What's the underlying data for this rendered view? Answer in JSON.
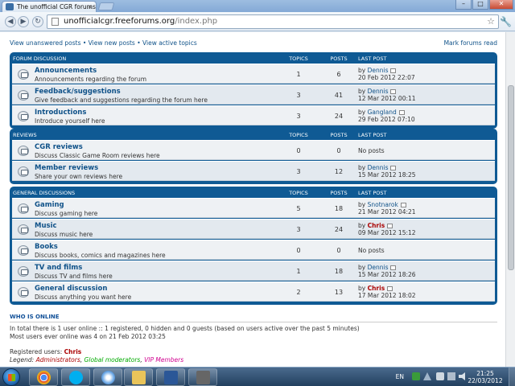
{
  "browser": {
    "tab_title": "The unofficial CGR forums",
    "tab_close": "×",
    "url_host": "unofficialcgr.freeforums.org",
    "url_path": "/index.php",
    "star": "☆",
    "wrench": "🔧",
    "back": "◀",
    "forward": "▶",
    "reload": "↻",
    "minimize": "–",
    "maximize": "□",
    "close": "✕"
  },
  "topbar": {
    "links": "View unanswered posts • View new posts • View active topics",
    "mark_read": "Mark forums read"
  },
  "headers": {
    "topics": "TOPICS",
    "posts": "POSTS",
    "last_post": "LAST POST"
  },
  "categories": [
    {
      "title": "FORUM DISCUSSION",
      "forums": [
        {
          "name": "Announcements",
          "desc": "Announcements regarding the forum",
          "topics": "1",
          "posts": "6",
          "by": "Dennis",
          "date": "20 Feb 2012 22:07",
          "admin": false
        },
        {
          "name": "Feedback/suggestions",
          "desc": "Give feedback and suggestions regarding the forum here",
          "topics": "3",
          "posts": "41",
          "by": "Dennis",
          "date": "12 Mar 2012 00:11",
          "admin": false
        },
        {
          "name": "Introductions",
          "desc": "Introduce yourself here",
          "topics": "3",
          "posts": "24",
          "by": "Gangland",
          "date": "29 Feb 2012 07:10",
          "admin": false
        }
      ]
    },
    {
      "title": "REVIEWS",
      "forums": [
        {
          "name": "CGR reviews",
          "desc": "Discuss Classic Game Room reviews here",
          "topics": "0",
          "posts": "0",
          "by": "",
          "date": "",
          "noposts": "No posts",
          "admin": false
        },
        {
          "name": "Member reviews",
          "desc": "Share your own reviews here",
          "topics": "3",
          "posts": "12",
          "by": "Dennis",
          "date": "15 Mar 2012 18:25",
          "admin": false
        }
      ]
    },
    {
      "title": "GENERAL DISCUSSIONS",
      "forums": [
        {
          "name": "Gaming",
          "desc": "Discuss gaming here",
          "topics": "5",
          "posts": "18",
          "by": "Snotnarok",
          "date": "21 Mar 2012 04:21",
          "admin": false
        },
        {
          "name": "Music",
          "desc": "Discuss music here",
          "topics": "3",
          "posts": "24",
          "by": "Chris",
          "date": "09 Mar 2012 15:12",
          "admin": true
        },
        {
          "name": "Books",
          "desc": "Discuss books, comics and magazines here",
          "topics": "0",
          "posts": "0",
          "by": "",
          "date": "",
          "noposts": "No posts",
          "admin": false
        },
        {
          "name": "TV and films",
          "desc": "Discuss TV and films here",
          "topics": "1",
          "posts": "18",
          "by": "Dennis",
          "date": "15 Mar 2012 18:26",
          "admin": false
        },
        {
          "name": "General discussion",
          "desc": "Discuss anything you want here",
          "topics": "2",
          "posts": "13",
          "by": "Chris",
          "date": "17 Mar 2012 18:02",
          "admin": true
        }
      ]
    }
  ],
  "who_online": {
    "heading": "WHO IS ONLINE",
    "line1": "In total there is 1 user online :: 1 registered, 0 hidden and 0 guests (based on users active over the past 5 minutes)",
    "line2": "Most users ever online was 4 on 21 Feb 2012 03:25",
    "registered_label": "Registered users: ",
    "registered_user": "Chris",
    "legend_label": "Legend: ",
    "legend_admin": "Administrators",
    "legend_sep1": ", ",
    "legend_gmod": "Global moderators",
    "legend_sep2": ", ",
    "legend_vip": "VIP Members"
  },
  "by_prefix": "by ",
  "taskbar": {
    "lang": "EN",
    "time": "21:25",
    "date": "22/03/2012"
  },
  "colors": {
    "forum_blue": "#0f5a94",
    "link": "#105289",
    "admin_red": "#aa0000"
  }
}
